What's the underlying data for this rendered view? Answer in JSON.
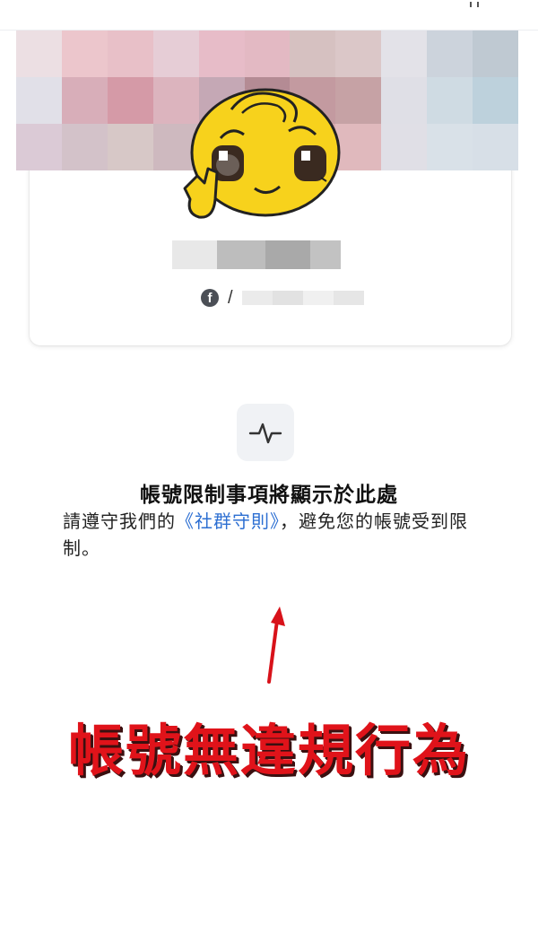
{
  "colors": {
    "link": "#2d6fd2",
    "annotation_red": "#e0131a",
    "avatar_yellow": "#f7d21c"
  },
  "profile": {
    "facebook_icon": "facebook-icon",
    "facebook_letter": "f",
    "handle_separator": "/"
  },
  "restrictions": {
    "icon": "activity-pulse-icon",
    "title": "帳號限制事項將顯示於此處",
    "desc_before": "請遵守我們的",
    "desc_link": "《社群守則》",
    "desc_after": "，避免您的帳號受到限制。"
  },
  "annotation": {
    "arrow_icon": "up-arrow-icon",
    "text": "帳號無違規行為"
  }
}
